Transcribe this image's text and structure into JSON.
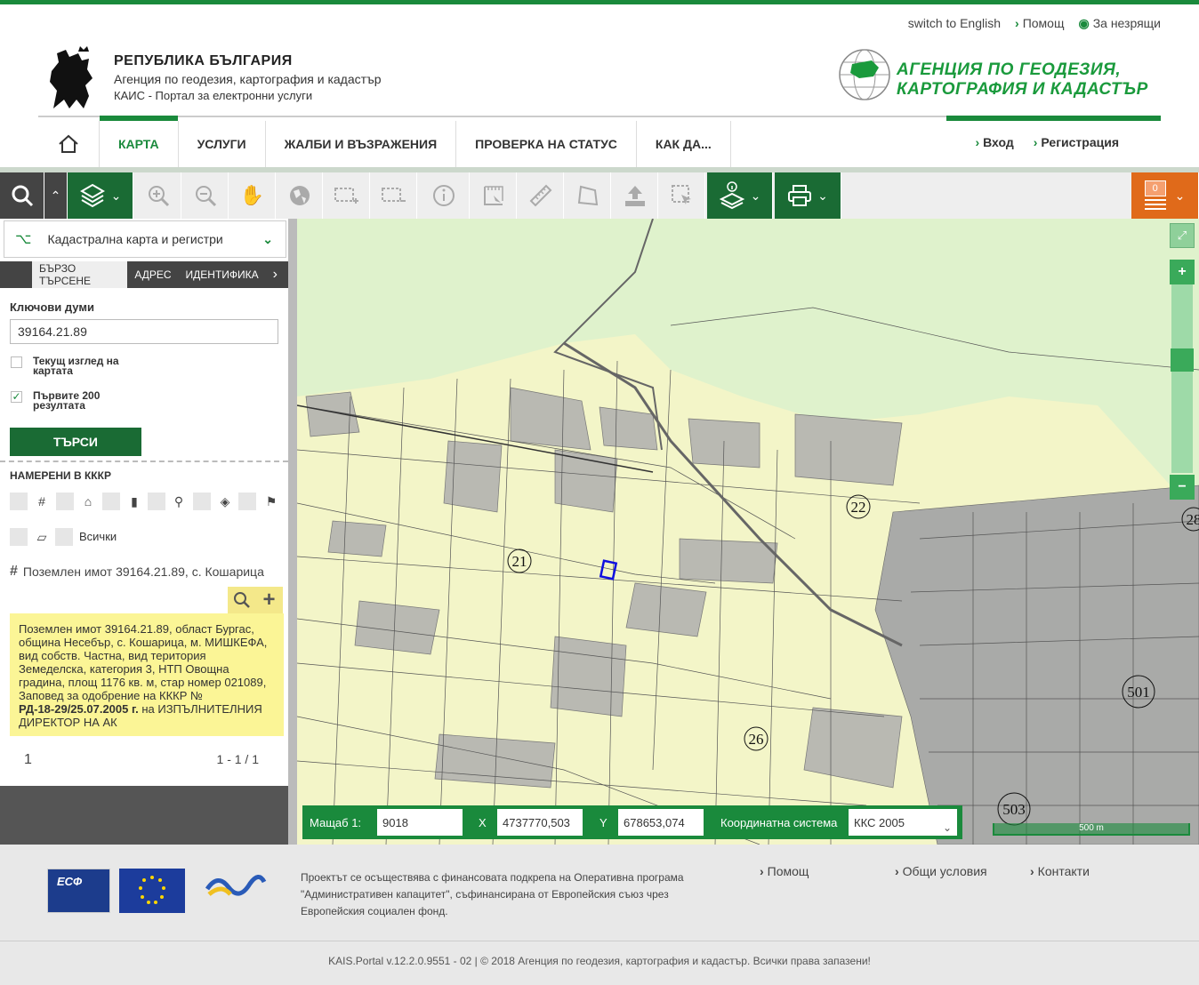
{
  "colors": {
    "brand_green": "#1a8a3c",
    "dark_green": "#1a6b34",
    "orange": "#e06a1a",
    "map_bg": "#f3f5c8",
    "info_yellow": "#fbf596"
  },
  "util_nav": {
    "language": "switch to English",
    "help": "Помощ",
    "accessibility": "За незрящи"
  },
  "brand": {
    "country": "РЕПУБЛИКА БЪЛГАРИЯ",
    "agency": "Агенция по геодезия, картография и кадастър",
    "portal": "КАИС - Портал за електронни услуги"
  },
  "agency_logo": {
    "line1": "АГЕНЦИЯ ПО ГЕОДЕЗИЯ,",
    "line2": "КАРТОГРАФИЯ И КАДАСТЪР"
  },
  "nav": {
    "items": [
      "КАРТА",
      "УСЛУГИ",
      "ЖАЛБИ И ВЪЗРАЖЕНИЯ",
      "ПРОВЕРКА НА СТАТУС",
      "КАК ДА..."
    ],
    "login": "Вход",
    "register": "Регистрация"
  },
  "toolbar": {
    "cart_count": "0",
    "icons": [
      "search-icon",
      "layers-icon",
      "zoom-in-icon",
      "zoom-out-icon",
      "pan-hand-icon",
      "globe-icon",
      "zoom-box-in-icon",
      "zoom-box-out-icon",
      "info-icon",
      "measure-area-icon",
      "ruler-icon",
      "polygon-icon",
      "upload-icon",
      "select-icon",
      "identify-layers-icon",
      "print-icon",
      "cart-icon"
    ]
  },
  "sidebar": {
    "layer": "Кадастрална карта и регистри",
    "tabs": [
      "БЪРЗО ТЪРСЕНЕ",
      "АДРЕС",
      "ИДЕНТИФИКА"
    ],
    "keywords_label": "Ключови думи",
    "keywords_value": "39164.21.89",
    "current_view_label_1": "Текущ изглед на",
    "current_view_label_2": "картата",
    "first200_label_1": "Първите 200",
    "first200_label_2": "резултата",
    "search_button": "ТЪРСИ",
    "found_heading": "НАМЕРЕНИ В КККР",
    "filter_all": "Всички",
    "result_title": "Поземлен имот 39164.21.89, с. Кошарица",
    "info_lines": [
      "Поземлен имот 39164.21.89, област Бургас,",
      "община Несебър, с. Кошарица, м. МИШКЕФА,",
      "вид собств. Частна, вид територия",
      "Земеделска, категория 3, НТП Овощна",
      "градина, площ 1176 кв. м, стар номер 021089,",
      "Заповед за одобрение на КККР №"
    ],
    "info_bold": "РД-18-29/25.07.2005 г.",
    "info_tail_1": " на ИЗПЪЛНИТЕЛНИЯ",
    "info_tail_2": "ДИРЕКТОР НА АК",
    "pager_page": "1",
    "pager_range": "1 - 1 / 1"
  },
  "map": {
    "labels": [
      "21",
      "22",
      "26",
      "501",
      "503",
      "28"
    ],
    "scale_label": "Мащаб  1:",
    "scale_value": "9018",
    "x_label": "X",
    "x_value": "4737770,503",
    "y_label": "Y",
    "y_value": "678653,074",
    "crs_label": "Координатна система",
    "crs_value": "ККС 2005",
    "scalebar": "500 m"
  },
  "footer": {
    "project_text_1": "Проектът се осъществява с финансовата подкрепа на Оперативна програма",
    "project_text_2": "\"Административен капацитет\", съфинансирана от Европейския съюз чрез",
    "project_text_3": "Европейския социален фонд.",
    "links": [
      "Помощ",
      "Общи условия",
      "Контакти"
    ],
    "esf": "ЕСФ",
    "copyright": "KAIS.Portal v.12.2.0.9551 - 02  |  © 2018 Агенция по геодезия, картография и кадастър. Всички права запазени!"
  }
}
